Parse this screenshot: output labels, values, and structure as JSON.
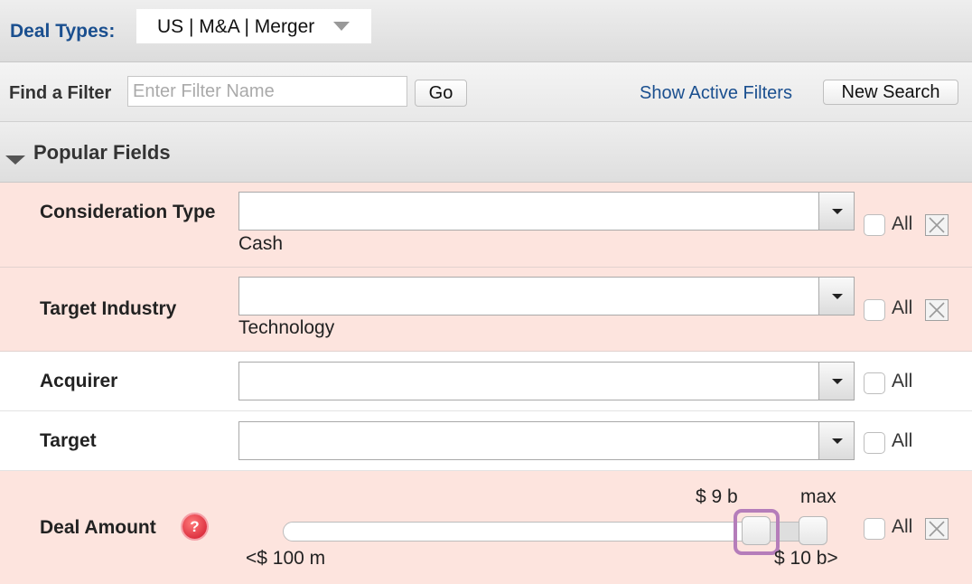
{
  "header": {
    "deal_types_label": "Deal Types:",
    "deal_types_value": "US | M&A | Merger"
  },
  "filterbar": {
    "find_label": "Find a Filter",
    "find_placeholder": "Enter Filter Name",
    "go_label": "Go",
    "show_active_label": "Show Active Filters",
    "new_search_label": "New Search"
  },
  "section": {
    "title": "Popular Fields"
  },
  "rows": [
    {
      "label": "Consideration Type",
      "value": "",
      "selected_text": "Cash",
      "all_label": "All",
      "all_checked": false,
      "has_clear": true,
      "highlighted": true
    },
    {
      "label": "Target Industry",
      "value": "",
      "selected_text": "Technology",
      "all_label": "All",
      "all_checked": false,
      "has_clear": true,
      "highlighted": true
    },
    {
      "label": "Acquirer",
      "value": "",
      "all_label": "All",
      "all_checked": false,
      "has_clear": false,
      "highlighted": false
    },
    {
      "label": "Target",
      "value": "",
      "all_label": "All",
      "all_checked": false,
      "has_clear": false,
      "highlighted": false
    }
  ],
  "deal_amount": {
    "label": "Deal Amount",
    "help_icon": "help-icon",
    "help_glyph": "?",
    "low_value_label": "$ 9 b",
    "high_value_label": "max",
    "min_label": "<$ 100 m",
    "max_label": "$ 10 b>",
    "all_label": "All",
    "all_checked": false,
    "low_fraction": 0.88,
    "high_fraction": 1.0
  },
  "colors": {
    "link": "#1a4f8f",
    "highlight_row": "#fde4de",
    "focus_ring": "#b57dba"
  }
}
